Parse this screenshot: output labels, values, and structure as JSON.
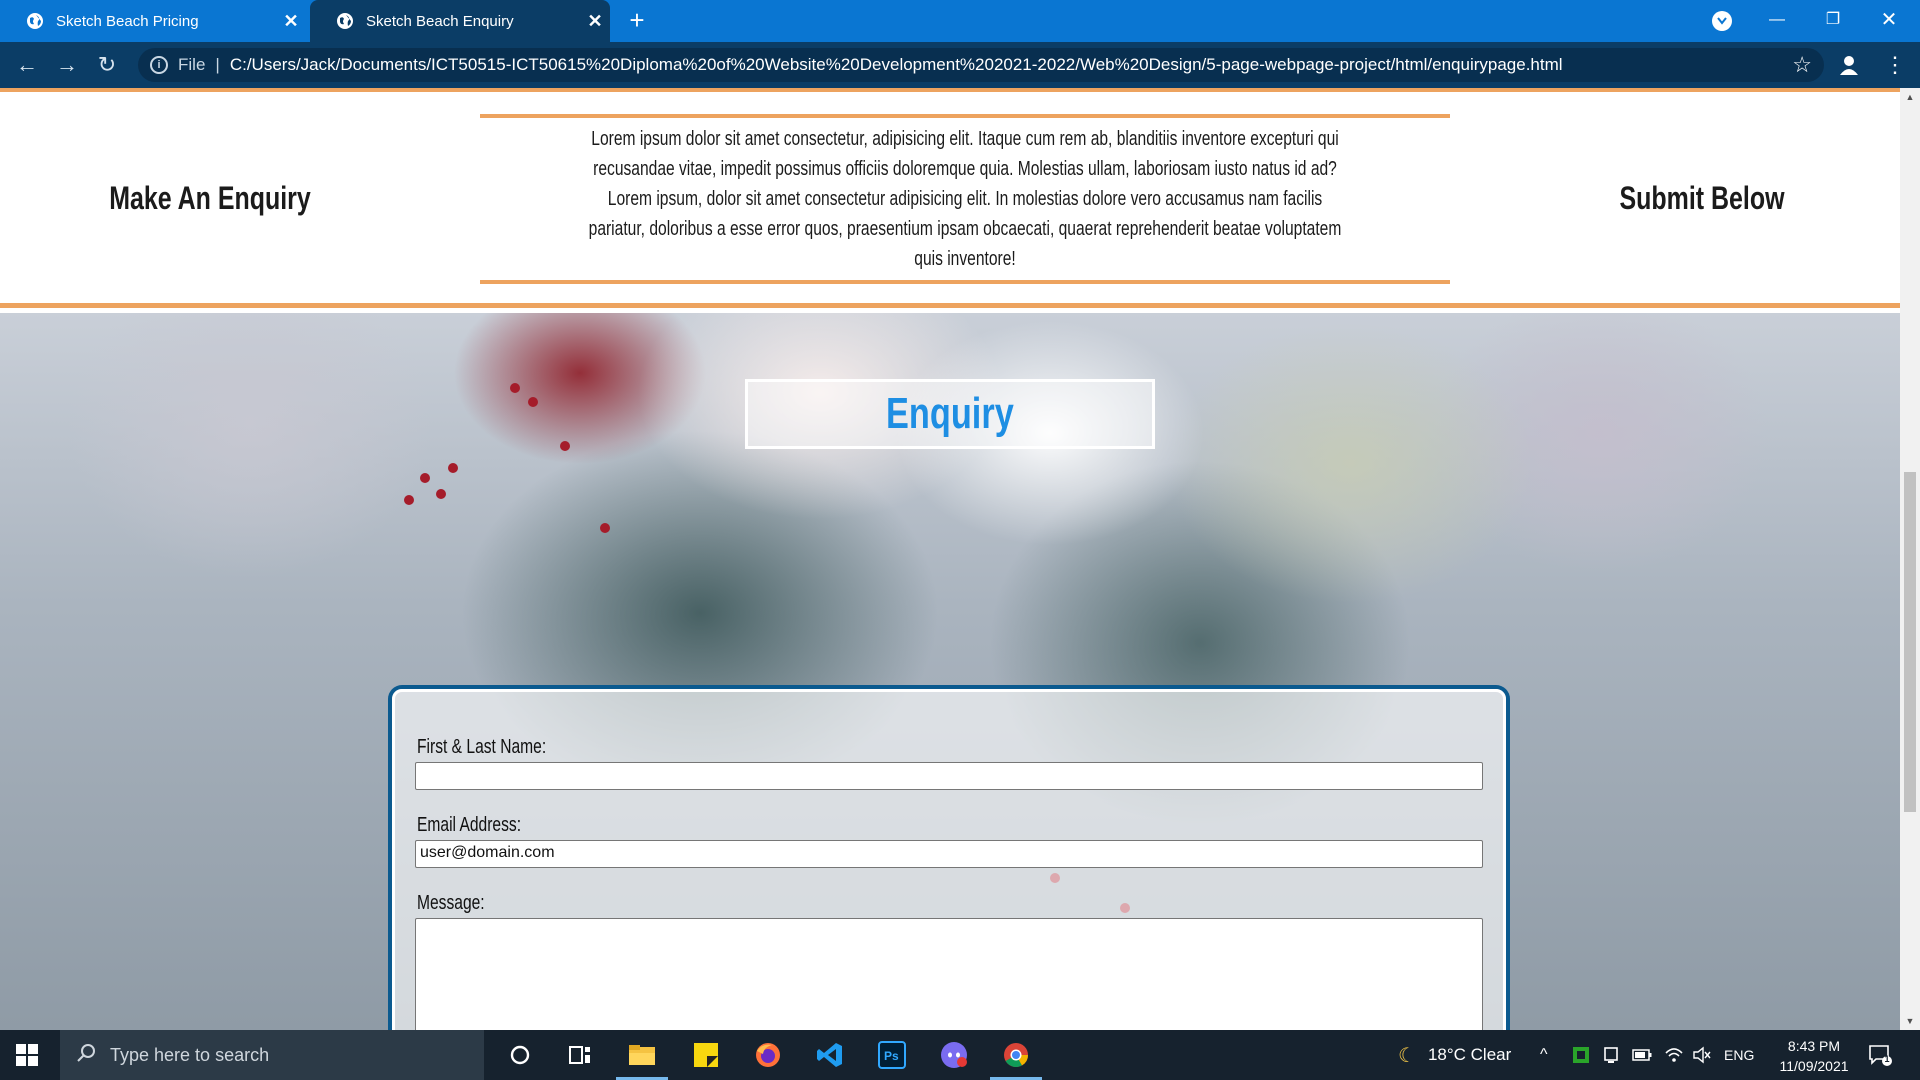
{
  "browser": {
    "tabs": [
      {
        "title": "Sketch Beach Pricing",
        "active": false
      },
      {
        "title": "Sketch Beach Enquiry",
        "active": true
      }
    ],
    "new_tab": "+",
    "address": {
      "scheme_label": "File",
      "url": "C:/Users/Jack/Documents/ICT50515-ICT50615%20Diploma%20of%20Website%20Development%202021-2022/Web%20Design/5-page-webpage-project/html/enquirypage.html"
    }
  },
  "page": {
    "left_heading": "Make An Enquiry",
    "right_heading": "Submit Below",
    "intro": "Lorem ipsum dolor sit amet consectetur, adipisicing elit. Itaque cum rem ab, blanditiis inventore excepturi qui recusandae vitae, impedit possimus officiis doloremque quia. Molestias ullam, laboriosam iusto natus id ad? Lorem ipsum, dolor sit amet consectetur adipisicing elit. In molestias dolore vero accusamus nam facilis pariatur, doloribus a esse error quos, praesentium ipsam obcaecati, quaerat reprehenderit beatae voluptatem quis inventore!",
    "enquiry_title": "Enquiry",
    "form": {
      "name_label": "First & Last Name:",
      "name_value": "",
      "email_label": "Email Address:",
      "email_value": "user@domain.com",
      "message_label": "Message:"
    },
    "accent_color": "#eda35f",
    "title_color": "#1e8ee3"
  },
  "taskbar": {
    "search_placeholder": "Type here to search",
    "weather": "18°C  Clear",
    "language": "ENG",
    "time": "8:43 PM",
    "date": "11/09/2021",
    "notification_count": "1"
  }
}
